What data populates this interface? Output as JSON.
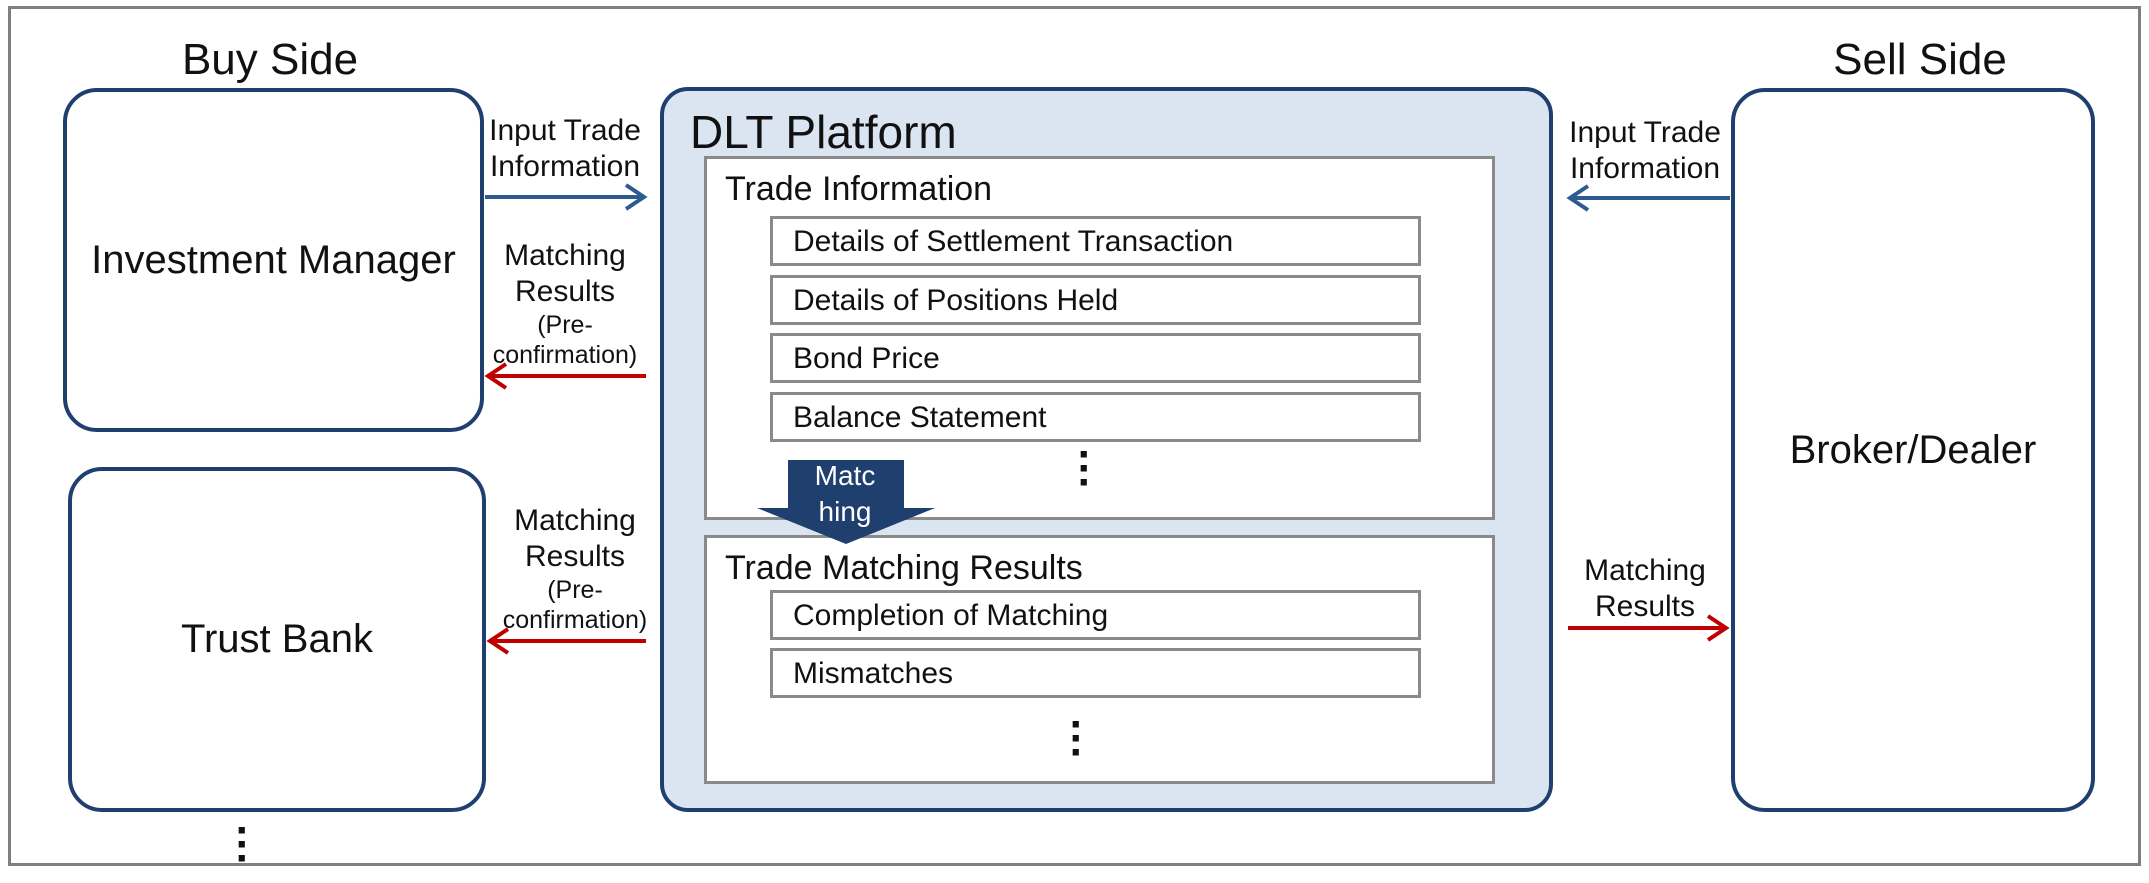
{
  "buy_side": {
    "title": "Buy Side",
    "investment_manager": "Investment Manager",
    "trust_bank": "Trust Bank"
  },
  "sell_side": {
    "title": "Sell Side",
    "broker_dealer": "Broker/Dealer"
  },
  "platform": {
    "title": "DLT Platform",
    "trade_information": {
      "title": "Trade Information",
      "items": [
        "Details of Settlement Transaction",
        "Details of Positions Held",
        "Bond Price",
        "Balance Statement"
      ]
    },
    "matching_arrow": {
      "line1": "Matc",
      "line2": "hing"
    },
    "trade_matching_results": {
      "title": "Trade Matching Results",
      "items": [
        "Completion of Matching",
        "Mismatches"
      ]
    }
  },
  "flows": {
    "im_input_line1": "Input Trade",
    "im_input_line2": "Information",
    "im_results_line1": "Matching",
    "im_results_line2": "Results",
    "im_results_line3": "(Pre-",
    "im_results_line4": "confirmation)",
    "tb_results_line1": "Matching",
    "tb_results_line2": "Results",
    "tb_results_line3": "(Pre-",
    "tb_results_line4": "confirmation)",
    "bd_input_line1": "Input Trade",
    "bd_input_line2": "Information",
    "bd_results_line1": "Matching",
    "bd_results_line2": "Results"
  },
  "colors": {
    "navy": "#1f3f6f",
    "input_arrow": "#2e5a92",
    "result_arrow": "#c00000",
    "platform_fill": "#dbe5f1"
  }
}
